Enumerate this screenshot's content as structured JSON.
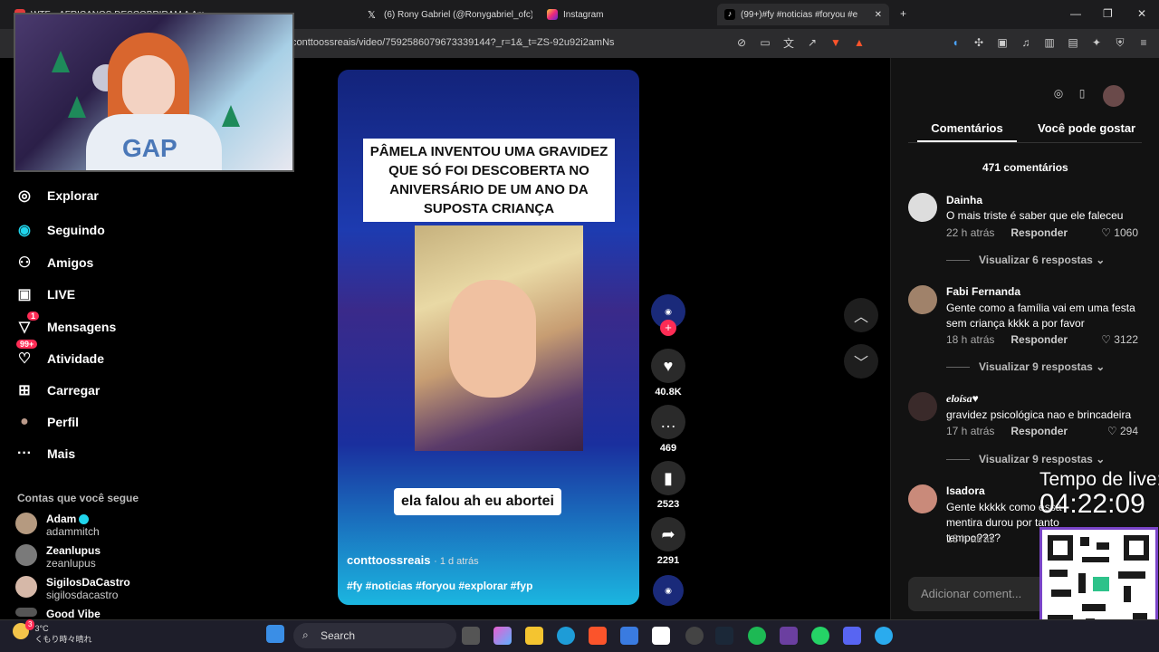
{
  "browser": {
    "tabs": [
      {
        "label": "WTF... AFRICANOS DESCOBRIRAM A Am",
        "active": false
      },
      {
        "label": "(6) Rony Gabriel (@Ronygabriel_ofc)",
        "active": false
      },
      {
        "label": "Instagram",
        "active": false
      },
      {
        "label": "(99+)#fy #noticias #foryou #e",
        "active": true
      }
    ],
    "url": "conttoossreais/video/7592586079673339144?_r=1&_t=ZS-92u92i2amNs",
    "new_tab": "+",
    "min": "—",
    "max": "❐",
    "close": "✕"
  },
  "sidebar": {
    "items": [
      {
        "label": "Explorar",
        "icon": "compass-icon",
        "glyph": "◎"
      },
      {
        "label": "Seguindo",
        "icon": "following-icon",
        "glyph": "◉"
      },
      {
        "label": "Amigos",
        "icon": "friends-icon",
        "glyph": "👥"
      },
      {
        "label": "LIVE",
        "icon": "live-icon",
        "glyph": "▣"
      },
      {
        "label": "Mensagens",
        "icon": "messages-icon",
        "glyph": "▽",
        "badge": "1"
      },
      {
        "label": "Atividade",
        "icon": "activity-icon",
        "glyph": "♡",
        "badge": "99+"
      },
      {
        "label": "Carregar",
        "icon": "upload-icon",
        "glyph": "⊞"
      },
      {
        "label": "Perfil",
        "icon": "profile-icon",
        "glyph": "●"
      },
      {
        "label": "Mais",
        "icon": "more-icon",
        "glyph": "···"
      }
    ],
    "following_title": "Contas que você segue",
    "following": [
      {
        "name": "Adam",
        "handle": "adammitch",
        "verified": true
      },
      {
        "name": "Zeanlupus",
        "handle": "zeanlupus"
      },
      {
        "name": "SigilosDaCastro",
        "handle": "sigilosdacastro"
      },
      {
        "name": "Good Vibe",
        "handle": ""
      }
    ]
  },
  "video": {
    "headline": "PÂMELA INVENTOU UMA GRAVIDEZ QUE SÓ FOI DESCOBERTA NO ANIVERSÁRIO DE UM ANO DA SUPOSTA CRIANÇA",
    "caption": "ela falou ah eu abortei",
    "author": "conttoossreais",
    "posted": "· 1 d atrás",
    "hashtags": "#fy #noticias #foryou #explorar #fyp"
  },
  "actions": {
    "likes": "40.8K",
    "comments": "469",
    "saves": "2523",
    "shares": "2291"
  },
  "panel": {
    "tab_comments": "Comentários",
    "tab_suggest": "Você pode gostar",
    "comment_count": "471 comentários",
    "reply_label": "Responder",
    "comments": [
      {
        "name": "Dainha",
        "text": "O mais triste é saber que ele faleceu",
        "time": "22 h atrás",
        "likes": "1060",
        "replies": "Visualizar 6 respostas"
      },
      {
        "name": "Fabi Fernanda",
        "text": "Gente como a família vai em uma festa sem criança kkkk a por favor",
        "time": "18 h atrás",
        "likes": "3122",
        "replies": "Visualizar 9 respostas"
      },
      {
        "name": "eloísa♥",
        "text": "gravidez psicológica nao e brincadeira",
        "time": "17 h atrás",
        "likes": "294",
        "replies": "Visualizar 9 respostas"
      },
      {
        "name": "Isadora",
        "text": "Gente kkkkk como essa mentira durou por tanto tempo????",
        "time": "18 h atrás",
        "likes": "",
        "replies": ""
      }
    ],
    "add_comment_placeholder": "Adicionar coment..."
  },
  "overlay": {
    "live_label": "Tempo de live:",
    "live_time": "04:22:09"
  },
  "taskbar": {
    "search": "Search",
    "weather_temp": "3°C",
    "weather_text": "くもり時々晴れ",
    "weather_badge": "3"
  },
  "colors": {
    "accent": "#fe2c55",
    "verified": "#20d5ec",
    "qr_frame": "#7a44c8"
  }
}
